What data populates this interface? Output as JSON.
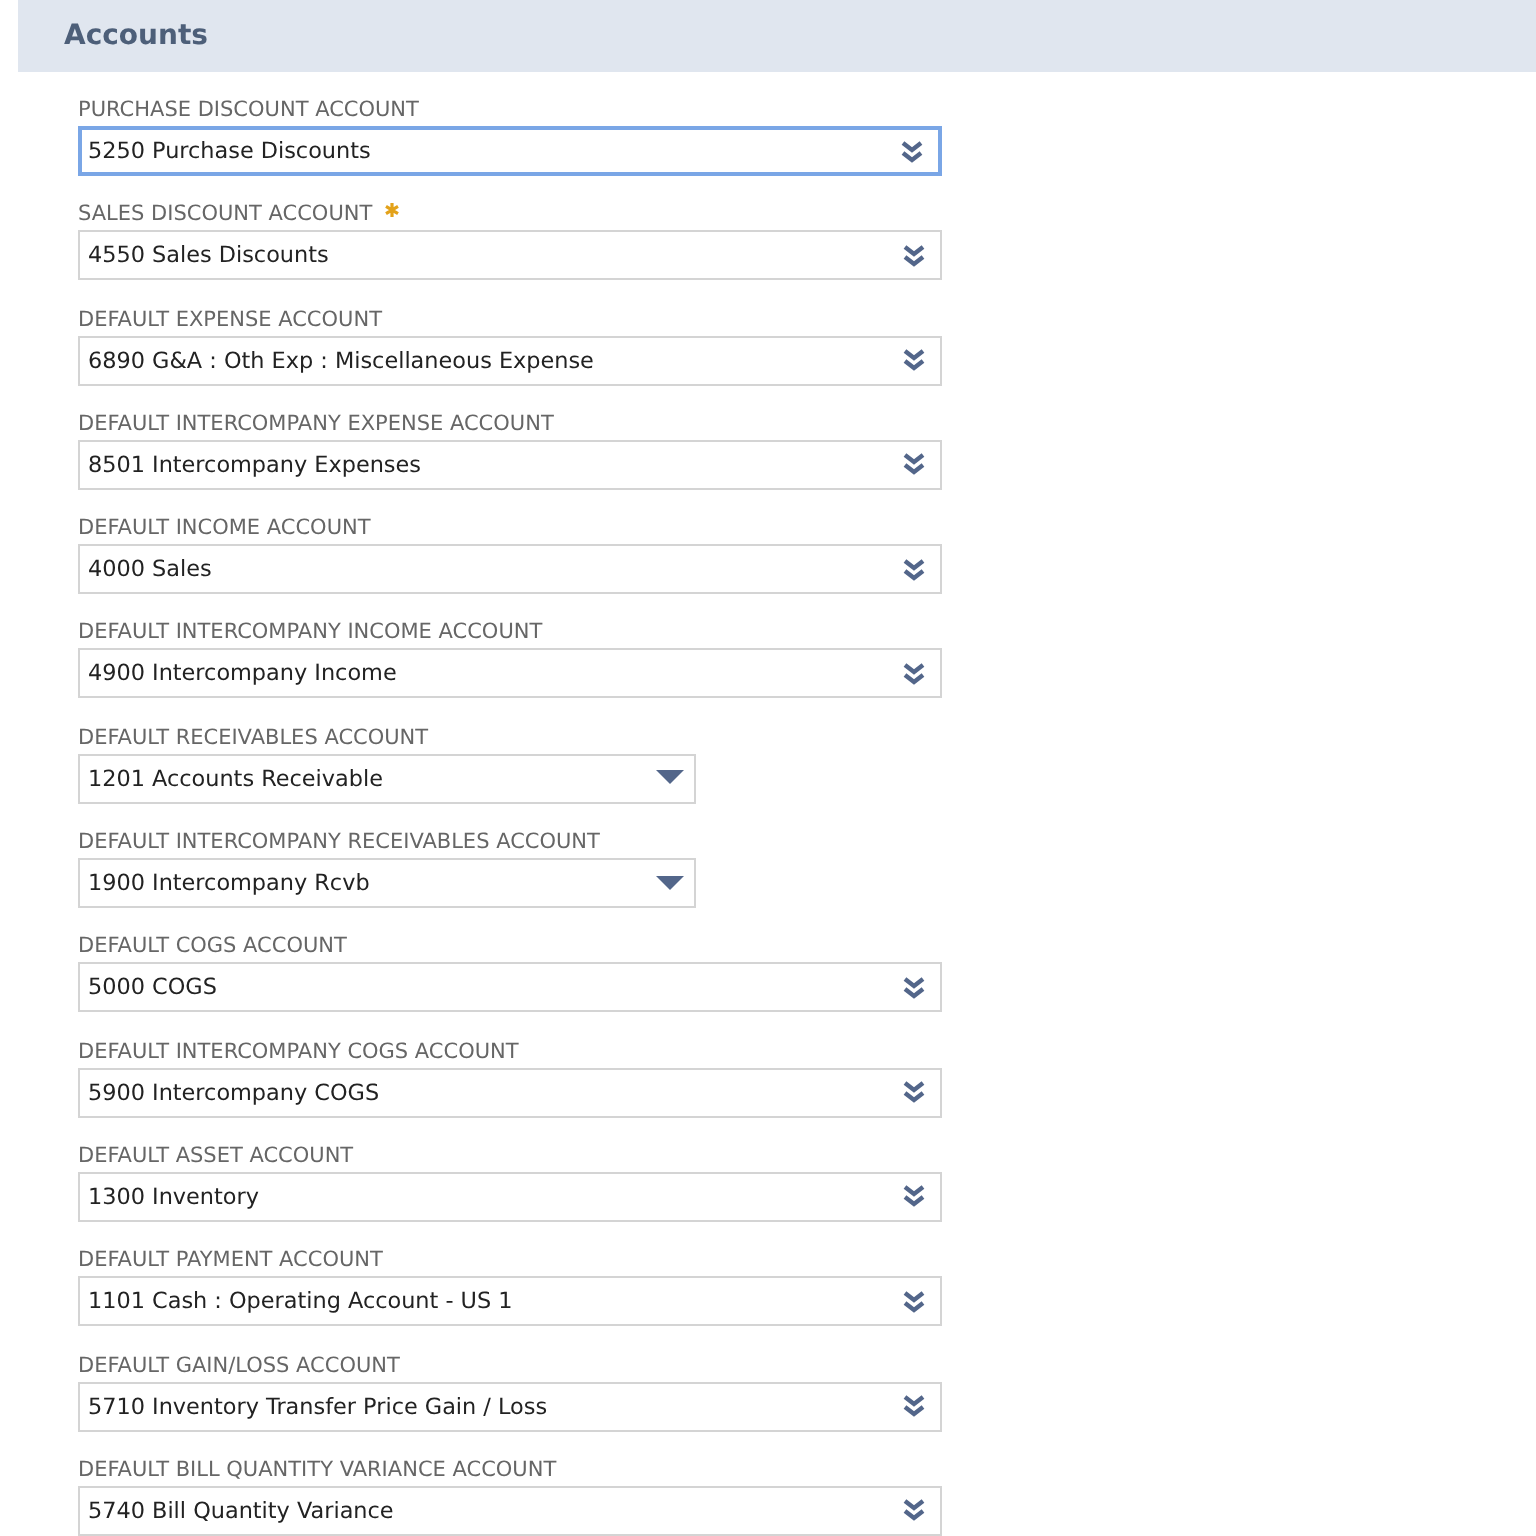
{
  "section": {
    "title": "Accounts"
  },
  "fields": [
    {
      "label": "PURCHASE DISCOUNT ACCOUNT",
      "value": "5250 Purchase Discounts",
      "kind": "popup",
      "focused": true,
      "required": false
    },
    {
      "label": "SALES DISCOUNT ACCOUNT",
      "value": "4550 Sales Discounts",
      "kind": "popup",
      "focused": false,
      "required": true
    },
    {
      "label": "DEFAULT EXPENSE ACCOUNT",
      "value": "6890 G&A : Oth Exp : Miscellaneous Expense",
      "kind": "popup",
      "focused": false,
      "required": false
    },
    {
      "label": "DEFAULT INTERCOMPANY EXPENSE ACCOUNT",
      "value": "8501 Intercompany Expenses",
      "kind": "popup",
      "focused": false,
      "required": false
    },
    {
      "label": "DEFAULT INCOME ACCOUNT",
      "value": "4000 Sales",
      "kind": "popup",
      "focused": false,
      "required": false
    },
    {
      "label": "DEFAULT INTERCOMPANY INCOME ACCOUNT",
      "value": "4900 Intercompany Income",
      "kind": "popup",
      "focused": false,
      "required": false
    },
    {
      "label": "DEFAULT RECEIVABLES ACCOUNT",
      "value": "1201 Accounts Receivable",
      "kind": "select",
      "focused": false,
      "required": false
    },
    {
      "label": "DEFAULT INTERCOMPANY RECEIVABLES ACCOUNT",
      "value": "1900 Intercompany Rcvb",
      "kind": "select",
      "focused": false,
      "required": false
    },
    {
      "label": "DEFAULT COGS ACCOUNT",
      "value": "5000 COGS",
      "kind": "popup",
      "focused": false,
      "required": false
    },
    {
      "label": "DEFAULT INTERCOMPANY COGS ACCOUNT",
      "value": "5900 Intercompany COGS",
      "kind": "popup",
      "focused": false,
      "required": false
    },
    {
      "label": "DEFAULT ASSET ACCOUNT",
      "value": "1300 Inventory",
      "kind": "popup",
      "focused": false,
      "required": false
    },
    {
      "label": "DEFAULT PAYMENT ACCOUNT",
      "value": "1101 Cash : Operating Account - US 1",
      "kind": "popup",
      "focused": false,
      "required": false
    },
    {
      "label": "DEFAULT GAIN/LOSS ACCOUNT",
      "value": "5710 Inventory Transfer Price Gain / Loss",
      "kind": "popup",
      "focused": false,
      "required": false
    },
    {
      "label": "DEFAULT BILL QUANTITY VARIANCE ACCOUNT",
      "value": "5740 Bill Quantity Variance",
      "kind": "popup",
      "focused": false,
      "required": false
    }
  ]
}
